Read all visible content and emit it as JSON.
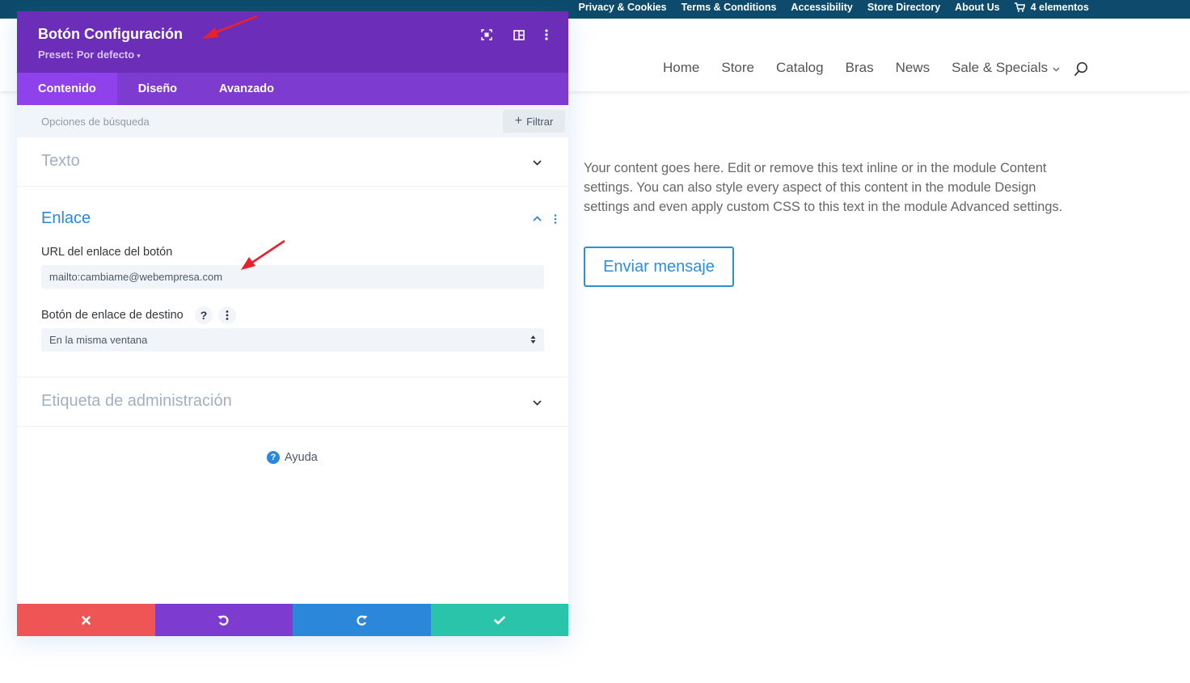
{
  "site": {
    "topbar": {
      "links": [
        "Privacy & Cookies",
        "Terms & Conditions",
        "Accessibility",
        "Store Directory",
        "About Us"
      ],
      "cart_label": "4 elementos"
    },
    "nav": {
      "items": [
        "Home",
        "Store",
        "Catalog",
        "Bras",
        "News",
        "Sale & Specials"
      ]
    },
    "content_text": "Your content goes here. Edit or remove this text inline or in the module Content settings. You can also style every aspect of this content in the module Design settings and even apply custom CSS to this text in the module Advanced settings.",
    "button_label": "Enviar mensaje"
  },
  "modal": {
    "title": "Botón Configuración",
    "preset": "Preset: Por defecto",
    "tabs": [
      "Contenido",
      "Diseño",
      "Avanzado"
    ],
    "active_tab": "Contenido",
    "search_placeholder": "Opciones de búsqueda",
    "filter_label": "Filtrar",
    "sections": {
      "texto": "Texto",
      "enlace": "Enlace",
      "etiqueta": "Etiqueta de administración"
    },
    "fields": {
      "url_label": "URL del enlace del botón",
      "url_value": "mailto:cambiame@webempresa.com",
      "target_label": "Botón de enlace de destino",
      "target_help": "?",
      "target_value": "En la misma ventana"
    },
    "help_label": "Ayuda",
    "help_badge": "?"
  },
  "colors": {
    "modal_header": "#6c2eb9",
    "tabs_bar": "#7d3bcf",
    "active_tab": "#8f42ec",
    "accent_blue": "#2b87da",
    "cancel": "#ef5555",
    "undo": "#7e3bd0",
    "redo": "#2b87da",
    "save": "#29c4a9",
    "topbar": "#0d4a6b",
    "annotation_arrow": "#e8222a"
  },
  "icons": {
    "header": [
      "expand-icon",
      "split-view-icon",
      "more-vertical-icon"
    ],
    "footer": [
      "close-icon",
      "undo-icon",
      "redo-icon",
      "check-icon"
    ]
  }
}
